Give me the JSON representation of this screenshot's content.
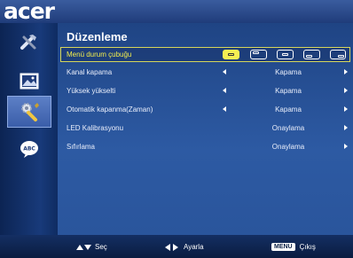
{
  "brand": {
    "logo": "acer"
  },
  "sidebar": {
    "items": [
      {
        "icon": "tools-icon",
        "selected": false
      },
      {
        "icon": "picture-icon",
        "selected": false
      },
      {
        "icon": "settings-gear-wrench-icon",
        "selected": true
      },
      {
        "icon": "language-abc-icon",
        "selected": false
      }
    ]
  },
  "panel": {
    "title": "Düzenleme",
    "rows": [
      {
        "label": "Menü durum çubuğu",
        "value": "",
        "left_arrow": false,
        "right_arrow": false
      },
      {
        "label": "Kanal kapama",
        "value": "Kapama",
        "left_arrow": true,
        "right_arrow": true
      },
      {
        "label": "Yüksek yükselti",
        "value": "Kapama",
        "left_arrow": true,
        "right_arrow": true
      },
      {
        "label": "Otomatik kapanma(Zaman)",
        "value": "Kapama",
        "left_arrow": true,
        "right_arrow": true
      },
      {
        "label": "LED Kalibrasyonu",
        "value": "Onaylama",
        "left_arrow": false,
        "right_arrow": true
      },
      {
        "label": "Sıfırlama",
        "value": "Onaylama",
        "left_arrow": false,
        "right_arrow": true
      }
    ],
    "menu_position_options": [
      "center",
      "top-left",
      "top-right",
      "bottom-left",
      "bottom-right"
    ],
    "menu_position_selected": "center"
  },
  "footer": {
    "select_label": "Seç",
    "adjust_label": "Ayarla",
    "menu_key": "MENU",
    "exit_label": "Çıkış"
  },
  "colors": {
    "highlight": "#f2ed4c",
    "panel": "#2d5aa3",
    "background": "#0b1f45"
  }
}
